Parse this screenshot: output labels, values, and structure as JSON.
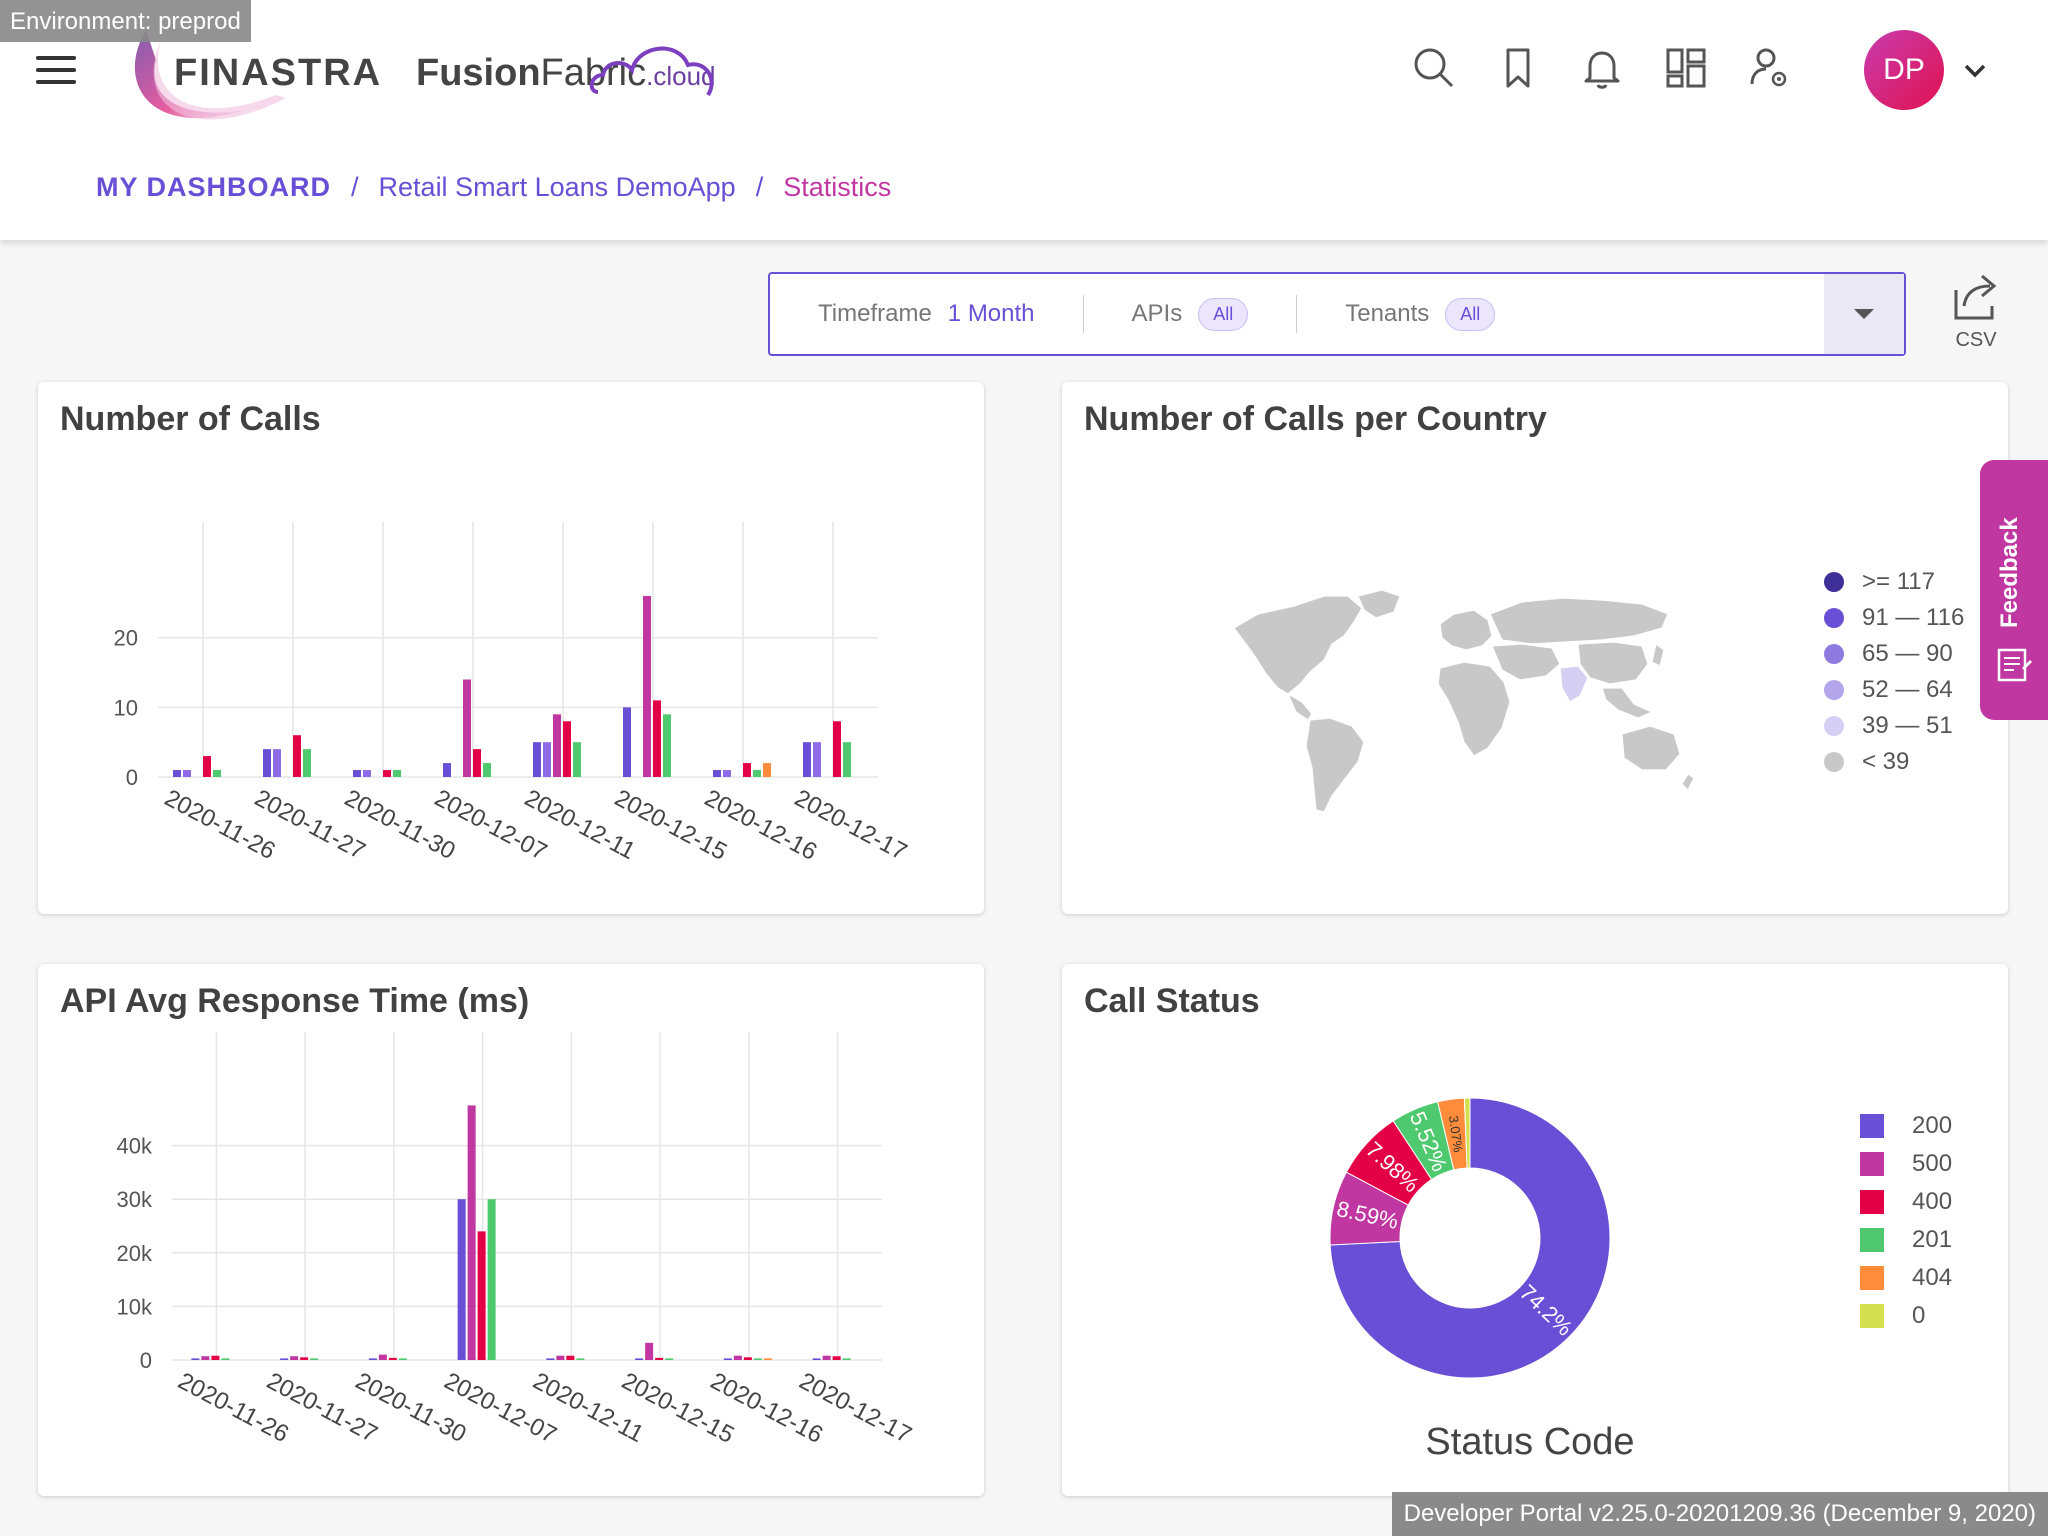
{
  "environment_badge": "Environment: preprod",
  "footer": "Developer Portal v2.25.0-20201209.36 (December 9, 2020)",
  "header": {
    "brand_left": "FINASTRA",
    "brand_right_bold": "Fusion",
    "brand_right_regular": "Fabric",
    "brand_right_small": ".cloud",
    "avatar_initials": "DP"
  },
  "breadcrumb": {
    "root": "MY DASHBOARD",
    "separator": "/",
    "app": "Retail Smart Loans DemoApp",
    "current": "Statistics"
  },
  "filters": {
    "timeframe_label": "Timeframe",
    "timeframe_value": "1 Month",
    "apis_label": "APIs",
    "apis_value": "All",
    "tenants_label": "Tenants",
    "tenants_value": "All",
    "csv_label": "CSV"
  },
  "feedback_label": "Feedback",
  "colors": {
    "accent": "#694ED6",
    "magenta": "#C137A2",
    "red": "#E40046",
    "green": "#4FC96F",
    "orange": "#FF8C3A",
    "yellow": "#D4DF4F",
    "map_grey": "#C8C8C8"
  },
  "cards": {
    "calls_title": "Number of Calls",
    "country_title": "Number of Calls per Country",
    "response_title": "API Avg Response Time (ms)",
    "status_title": "Call Status"
  },
  "country_legend": [
    {
      "label": ">= 117",
      "color": "#3F2F99"
    },
    {
      "label": "91 — 116",
      "color": "#694ED6"
    },
    {
      "label": "65 — 90",
      "color": "#8F7BE0"
    },
    {
      "label": "52 — 64",
      "color": "#B2A5EA"
    },
    {
      "label": "39 — 51",
      "color": "#D6CFF4"
    },
    {
      "label": "< 39",
      "color": "#C8C8C8"
    }
  ],
  "chart_data": [
    {
      "type": "bar",
      "title": "Number of Calls",
      "categories": [
        "2020-11-26",
        "2020-11-27",
        "2020-11-30",
        "2020-12-07",
        "2020-12-11",
        "2020-12-15",
        "2020-12-16",
        "2020-12-17"
      ],
      "ylim": [
        0,
        28
      ],
      "yticks": [
        0,
        10,
        20
      ],
      "series": [
        {
          "color": "#694ED6",
          "values": [
            1,
            4,
            1,
            2,
            5,
            10,
            1,
            5
          ]
        },
        {
          "color": "#8F6BE8",
          "values": [
            1,
            4,
            1,
            0,
            5,
            0,
            1,
            5
          ]
        },
        {
          "color": "#C137A2",
          "values": [
            0,
            0,
            0,
            14,
            9,
            26,
            0,
            0
          ]
        },
        {
          "color": "#E40046",
          "values": [
            3,
            6,
            1,
            4,
            8,
            11,
            2,
            8
          ]
        },
        {
          "color": "#4FC96F",
          "values": [
            1,
            4,
            1,
            2,
            5,
            9,
            1,
            5
          ]
        },
        {
          "color": "#FF8C3A",
          "values": [
            0,
            0,
            0,
            0,
            0,
            0,
            2,
            0
          ]
        }
      ]
    },
    {
      "type": "bar",
      "title": "API Avg Response Time (ms)",
      "categories": [
        "2020-11-26",
        "2020-11-27",
        "2020-11-30",
        "2020-12-07",
        "2020-12-11",
        "2020-12-15",
        "2020-12-16",
        "2020-12-17"
      ],
      "ylim": [
        0,
        50000
      ],
      "yticks": [
        0,
        10000,
        20000,
        30000,
        40000
      ],
      "ytick_labels": [
        "0",
        "10k",
        "20k",
        "30k",
        "40k"
      ],
      "series": [
        {
          "color": "#694ED6",
          "values": [
            300,
            300,
            300,
            30000,
            300,
            300,
            300,
            300
          ]
        },
        {
          "color": "#C137A2",
          "values": [
            700,
            700,
            1000,
            47500,
            800,
            3200,
            800,
            800
          ]
        },
        {
          "color": "#E40046",
          "values": [
            800,
            500,
            400,
            24000,
            800,
            400,
            500,
            700
          ]
        },
        {
          "color": "#4FC96F",
          "values": [
            300,
            300,
            300,
            30000,
            300,
            300,
            300,
            300
          ]
        },
        {
          "color": "#FF8C3A",
          "values": [
            0,
            0,
            0,
            0,
            0,
            0,
            300,
            0
          ]
        }
      ]
    },
    {
      "type": "pie",
      "title": "Call Status",
      "xlabel": "Status Code",
      "labels": [
        "200",
        "500",
        "400",
        "201",
        "404",
        "0"
      ],
      "values": [
        74.2,
        8.59,
        7.98,
        5.52,
        3.07,
        0.64
      ],
      "value_labels": [
        "74.2%",
        "8.59%",
        "7.98%",
        "5.52%",
        "3.07%",
        ""
      ],
      "colors": [
        "#694ED6",
        "#C137A2",
        "#E40046",
        "#4FC96F",
        "#FF8C3A",
        "#D4DF4F"
      ]
    }
  ]
}
